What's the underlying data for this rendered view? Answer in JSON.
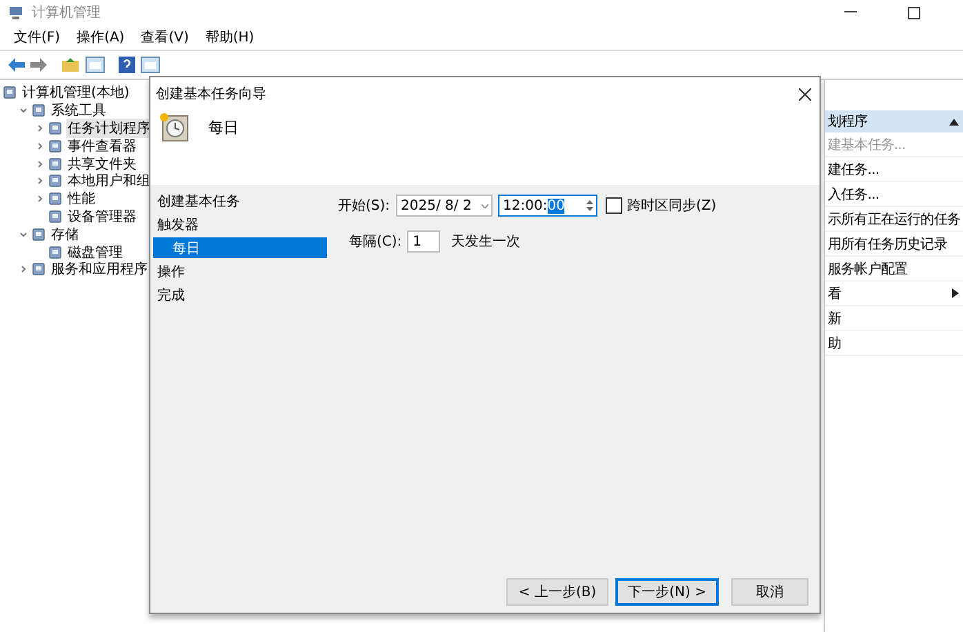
{
  "window": {
    "title": "计算机管理"
  },
  "menu": [
    "文件(F)",
    "操作(A)",
    "查看(V)",
    "帮助(H)"
  ],
  "tree": [
    {
      "label": "计算机管理(本地)",
      "selected": false,
      "children": [
        {
          "label": "系统工具",
          "selected": false,
          "expanded": true,
          "children": [
            {
              "label": "任务计划程序",
              "selected": true,
              "expanded": false
            },
            {
              "label": "事件查看器",
              "selected": false,
              "expanded": false
            },
            {
              "label": "共享文件夹",
              "selected": false,
              "expanded": false
            },
            {
              "label": "本地用户和组",
              "selected": false,
              "expanded": false
            },
            {
              "label": "性能",
              "selected": false,
              "expanded": false
            },
            {
              "label": "设备管理器",
              "selected": false
            }
          ]
        },
        {
          "label": "存储",
          "selected": false,
          "expanded": true,
          "children": [
            {
              "label": "磁盘管理",
              "selected": false
            }
          ]
        },
        {
          "label": "服务和应用程序",
          "selected": false,
          "expanded": false
        }
      ]
    }
  ],
  "actions": {
    "header": "划程序",
    "items": [
      {
        "label": "建基本任务...",
        "disabled": true,
        "submenu": false
      },
      {
        "label": "建任务...",
        "disabled": false,
        "submenu": false
      },
      {
        "label": "入任务...",
        "disabled": false,
        "submenu": false
      },
      {
        "label": "示所有正在运行的任务",
        "disabled": false,
        "submenu": false
      },
      {
        "label": "用所有任务历史记录",
        "disabled": false,
        "submenu": false
      },
      {
        "label": "服务帐户配置",
        "disabled": false,
        "submenu": false
      },
      {
        "label": "看",
        "disabled": false,
        "submenu": true
      },
      {
        "label": "新",
        "disabled": false,
        "submenu": false
      },
      {
        "label": "助",
        "disabled": false,
        "submenu": false
      }
    ]
  },
  "dialog": {
    "title": "创建基本任务向导",
    "heading": "每日",
    "steps": [
      {
        "label": "创建基本任务",
        "selected": false,
        "indented": false
      },
      {
        "label": "触发器",
        "selected": false,
        "indented": false
      },
      {
        "label": "每日",
        "selected": true,
        "indented": true
      },
      {
        "label": "操作",
        "selected": false,
        "indented": false
      },
      {
        "label": "完成",
        "selected": false,
        "indented": false
      }
    ],
    "start_label": "开始(S):",
    "date": "2025/ 8/ 2",
    "time": [
      {
        "text": "12:00:",
        "selected": false
      },
      {
        "text": "00",
        "selected": true
      }
    ],
    "sync": {
      "label": "跨时区同步(Z)",
      "checked": false
    },
    "every_label": "每隔(C):",
    "every_value": "1",
    "every_suffix": "天发生一次",
    "buttons": [
      {
        "label": "< 上一步(B)",
        "focused": false
      },
      {
        "label": "下一步(N) >",
        "focused": true
      },
      {
        "label": "取消",
        "focused": false
      }
    ]
  }
}
